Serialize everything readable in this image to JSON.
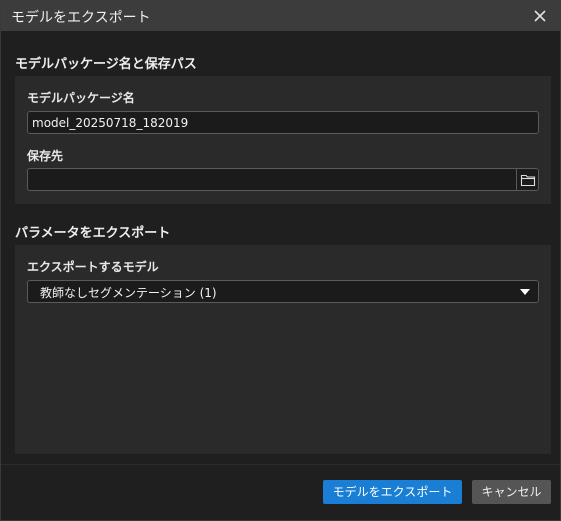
{
  "window": {
    "title": "モデルをエクスポート",
    "close_icon": "close-icon"
  },
  "package_section": {
    "title": "モデルパッケージ名と保存パス",
    "name_label": "モデルパッケージ名",
    "name_value": "model_20250718_182019",
    "path_label": "保存先",
    "path_value": "",
    "browse_icon": "folder-icon"
  },
  "params_section": {
    "title": "パラメータをエクスポート",
    "model_label": "エクスポートするモデル",
    "model_selected": "教師なしセグメンテーション (1)",
    "dropdown_icon": "caret-down-icon"
  },
  "footer": {
    "export_label": "モデルをエクスポート",
    "cancel_label": "キャンセル"
  },
  "colors": {
    "accent": "#1a7fd4",
    "background": "#1f1f1f",
    "panel": "#2a2a2a",
    "titlebar": "#3c3c3c"
  }
}
